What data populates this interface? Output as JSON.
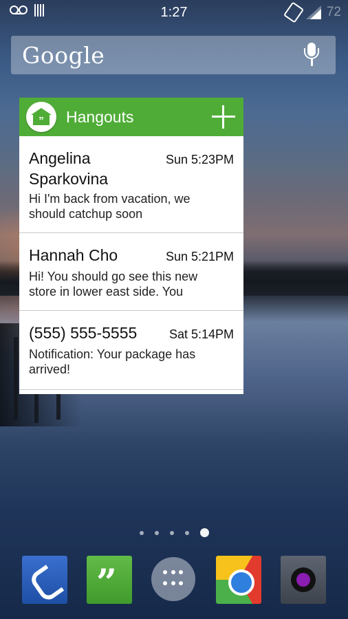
{
  "status_bar": {
    "time": "1:27",
    "battery_level": "72",
    "left_icons": [
      "voicemail-icon",
      "notification-bars-icon"
    ],
    "right_icons": [
      "rotation-icon",
      "signal-icon"
    ]
  },
  "search": {
    "logo_text": "Google",
    "icon": "microphone-icon"
  },
  "hangouts_widget": {
    "title": "Hangouts",
    "accent_color": "#4fad37",
    "logo_glyph": "”",
    "conversations": [
      {
        "name": "Angelina Sparkovina",
        "time": "Sun 5:23PM",
        "message": "Hi I'm back from vacation, we should catchup soon"
      },
      {
        "name": "Hannah Cho",
        "time": "Sun 5:21PM",
        "message": "Hi! You should go see this new store in lower east side. You"
      },
      {
        "name": "(555) 555-5555",
        "time": "Sat 5:14PM",
        "message": "Notification: Your package has arrived!"
      }
    ]
  },
  "page_indicator": {
    "count": 5,
    "active_index": 4
  },
  "dock": {
    "apps": [
      {
        "name": "Phone",
        "icon": "phone-icon"
      },
      {
        "name": "Hangouts",
        "icon": "hangouts-icon",
        "glyph": "”"
      },
      {
        "name": "All apps",
        "icon": "app-drawer-icon"
      },
      {
        "name": "Chrome",
        "icon": "chrome-icon"
      },
      {
        "name": "Camera",
        "icon": "camera-icon"
      }
    ]
  }
}
